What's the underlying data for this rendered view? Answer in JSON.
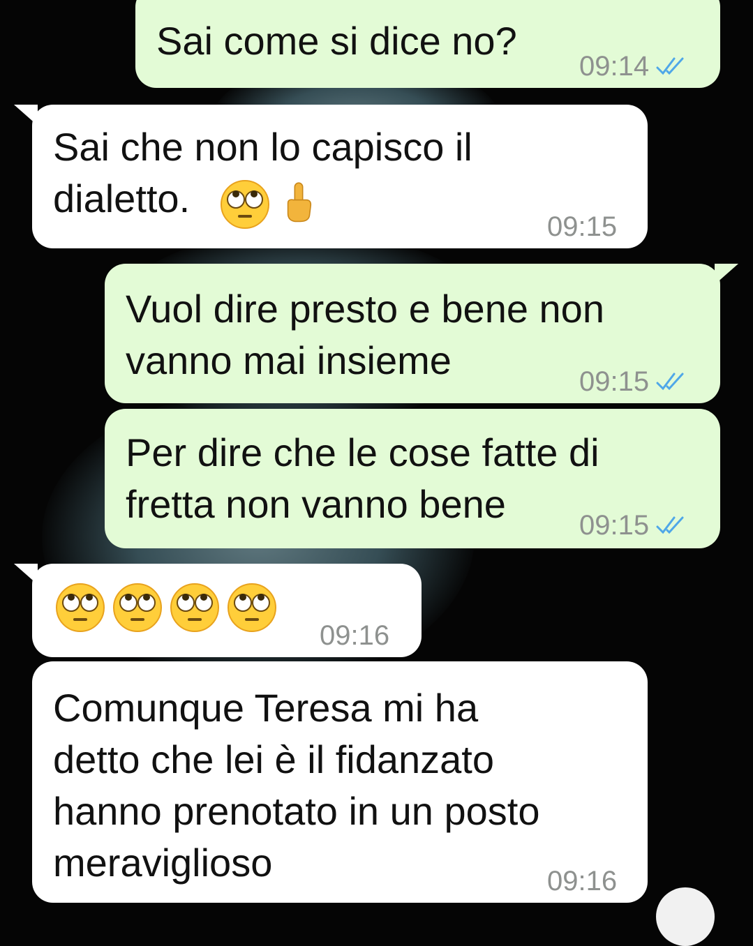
{
  "messages": [
    {
      "id": "m1",
      "direction": "outgoing",
      "text": "Sai come si dice no?",
      "time": "09:14",
      "status": "read"
    },
    {
      "id": "m2",
      "direction": "incoming",
      "text": "Sai che non lo capisco il\ndialetto.",
      "emojis": [
        "face-with-rolling-eyes",
        "middle-finger"
      ],
      "time": "09:15"
    },
    {
      "id": "m3",
      "direction": "outgoing",
      "text": "Vuol dire presto e bene non\nvanno mai insieme",
      "time": "09:15",
      "status": "read"
    },
    {
      "id": "m4",
      "direction": "outgoing",
      "text": "Per dire che le cose fatte di\nfretta non vanno bene",
      "time": "09:15",
      "status": "read"
    },
    {
      "id": "m5",
      "direction": "incoming",
      "text": "",
      "emojis": [
        "face-with-rolling-eyes",
        "face-with-rolling-eyes",
        "face-with-rolling-eyes",
        "face-with-rolling-eyes"
      ],
      "time": "09:16"
    },
    {
      "id": "m6",
      "direction": "incoming",
      "text": "Comunque Teresa mi ha\ndetto che lei è il fidanzato\nhanno prenotato in un posto\nmeraviglioso",
      "time": "09:16"
    }
  ],
  "colors": {
    "outgoing_bubble": "#e3fbd6",
    "incoming_bubble": "#ffffff",
    "read_ticks": "#4fa7e8",
    "timestamp": "#8e918f"
  }
}
